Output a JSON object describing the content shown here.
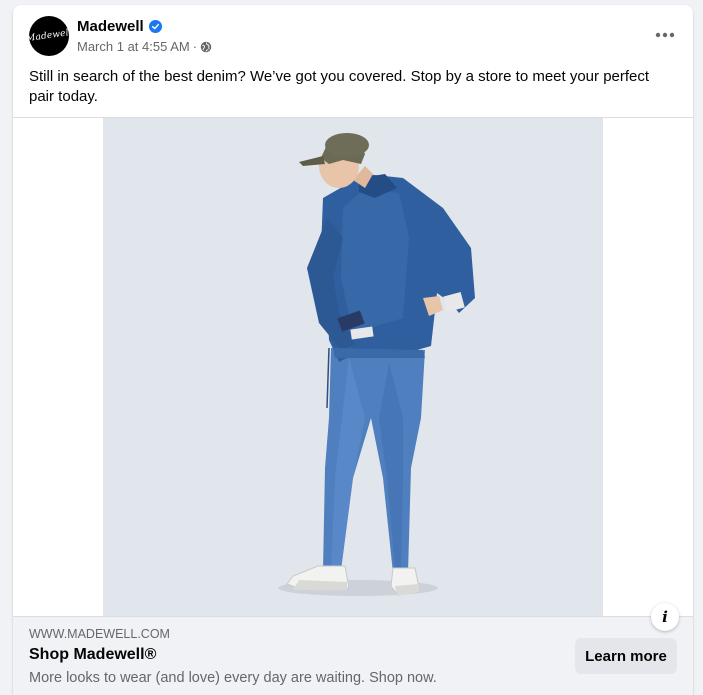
{
  "post": {
    "page_name": "Madewell",
    "avatar_text": "Madewell",
    "timestamp": "March 1 at 4:55 AM",
    "separator": "·",
    "caption": "Still in search of the best denim? We’ve got you covered. Stop by a store to meet your perfect pair today.",
    "icons": {
      "verified": "verified-badge-icon",
      "privacy": "globe-icon",
      "more": "more-options-icon",
      "info": "info-icon"
    },
    "verified_color": "#1877f2"
  },
  "link_preview": {
    "domain": "WWW.MADEWELL.COM",
    "title": "Shop Madewell®",
    "description": "More looks to wear (and love) every day are waiting. Shop now.",
    "cta_label": "Learn more"
  },
  "info_label": "i"
}
